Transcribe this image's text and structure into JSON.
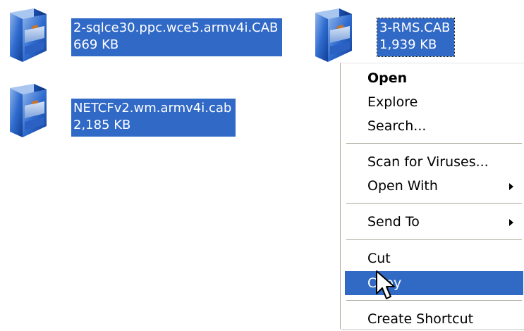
{
  "files": [
    {
      "name": "2-sqlce30.ppc.wce5.armv4i.CAB",
      "size": "669 KB"
    },
    {
      "name": "3-RMS.CAB",
      "size": "1,939 KB"
    },
    {
      "name": "NETCFv2.wm.armv4i.cab",
      "size": "2,185 KB"
    }
  ],
  "context_menu": {
    "open": "Open",
    "explore": "Explore",
    "search": "Search...",
    "scan": "Scan for Viruses...",
    "open_with": "Open With",
    "send_to": "Send To",
    "cut": "Cut",
    "copy": "Copy",
    "create_shortcut": "Create Shortcut"
  },
  "icons": {
    "file": "cabinet-file-icon",
    "cursor": "mouse-pointer-icon",
    "submenu": "submenu-arrow-icon"
  },
  "colors": {
    "selection": "#3169c6",
    "menu_highlight": "#316ac5",
    "selection_text": "#ffffff"
  }
}
